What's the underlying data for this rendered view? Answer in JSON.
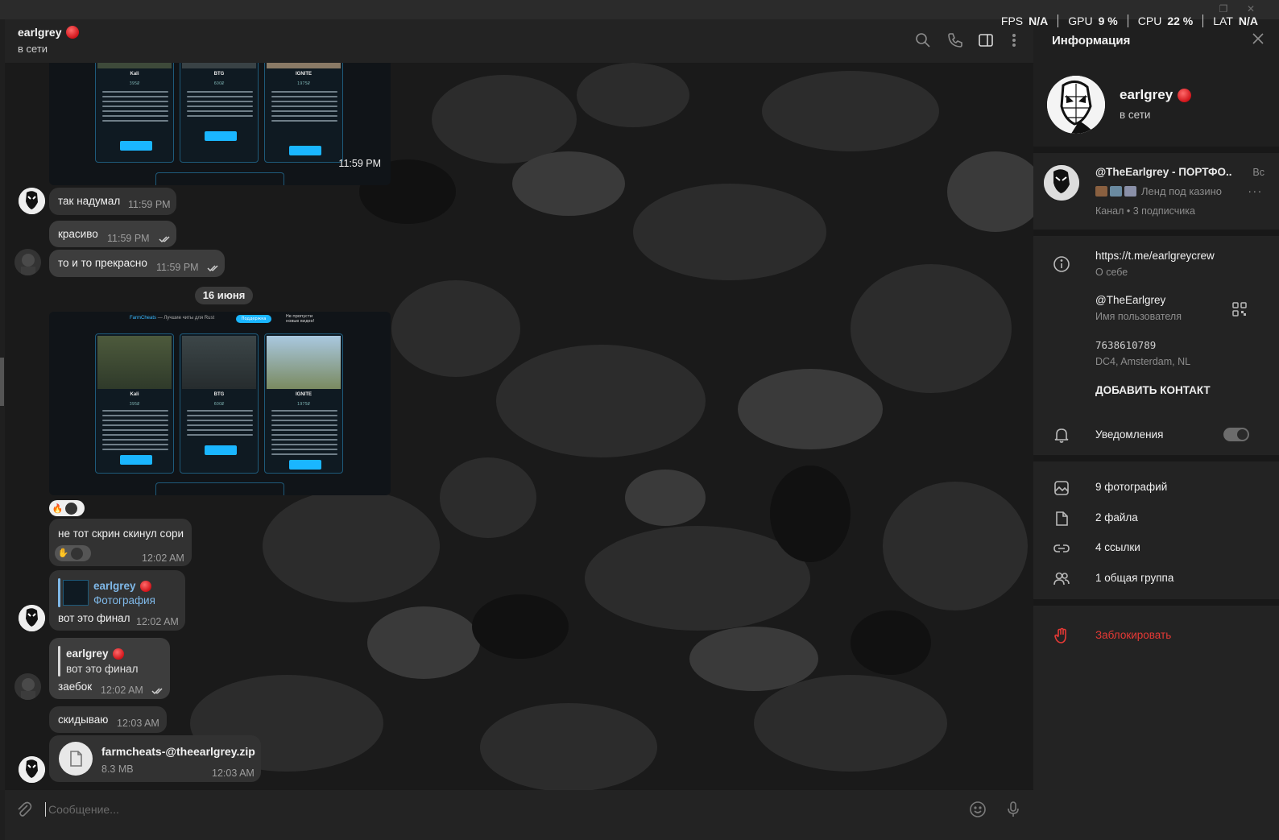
{
  "overlay": {
    "fps_label": "FPS",
    "fps_value": "N/A",
    "gpu_label": "GPU",
    "gpu_value": "9 %",
    "cpu_label": "CPU",
    "cpu_value": "22 %",
    "lat_label": "LAT",
    "lat_value": "N/A"
  },
  "chat_header": {
    "name": "earlgrey",
    "status": "в сети",
    "icons": [
      "search-icon",
      "phone-icon",
      "sidebar-toggle-icon",
      "more-vertical-icon"
    ]
  },
  "messages": {
    "img1_time": "11:59 PM",
    "cards": [
      {
        "name": "Kali",
        "price": "395₽"
      },
      {
        "name": "BTG",
        "price": "600₽"
      },
      {
        "name": "IGNITE",
        "price": "1975₽"
      }
    ],
    "m1": {
      "text": "так надумал",
      "time": "11:59 PM"
    },
    "m2": {
      "text": "красиво",
      "time": "11:59 PM"
    },
    "m3": {
      "text": "то и то прекрасно",
      "time": "11:59 PM"
    },
    "date": "16 июня",
    "img2_brand": "FarmCheats",
    "img2_tagline": "— Лучшие читы для Rust",
    "img2_support": "Поддержка",
    "img2_promo": "Не пропусти новые видео!",
    "m4": {
      "text": "не тот скрин скинул сори",
      "time": "12:02 AM"
    },
    "m5": {
      "reply_name": "earlgrey",
      "reply_text": "Фотография",
      "text": "вот это финал",
      "time": "12:02 AM"
    },
    "m6": {
      "reply_name": "earlgrey",
      "reply_text": "вот это финал",
      "text": "заебок",
      "time": "12:02 AM"
    },
    "m7": {
      "text": "скидываю",
      "time": "12:03 AM"
    },
    "file": {
      "name": "farmcheats-@theearlgrey.zip",
      "size": "8.3 MB",
      "time": "12:03 AM"
    }
  },
  "composer": {
    "placeholder": "Сообщение..."
  },
  "info": {
    "title": "Информация",
    "name": "earlgrey",
    "status": "в сети",
    "channel": {
      "title": "@TheEarlgrey - ПОРТФО...",
      "day": "Вс",
      "preview": "Ленд под казино",
      "meta": "Канал • 3 подписчика"
    },
    "link": "https://t.me/earlgreycrew",
    "link_label": "О себе",
    "username": "@TheEarlgrey",
    "username_label": "Имя пользователя",
    "id": "7638610789",
    "dc": "DC4, Amsterdam, NL",
    "add_contact": "ДОБАВИТЬ КОНТАКТ",
    "notifications": "Уведомления",
    "photos": "9 фотографий",
    "files": "2 файла",
    "links": "4 ссылки",
    "groups": "1 общая группа",
    "block": "Заблокировать"
  },
  "colors": {
    "accent": "#7fb8e8",
    "danger": "#e53935",
    "status_dot": "#d0141a"
  }
}
